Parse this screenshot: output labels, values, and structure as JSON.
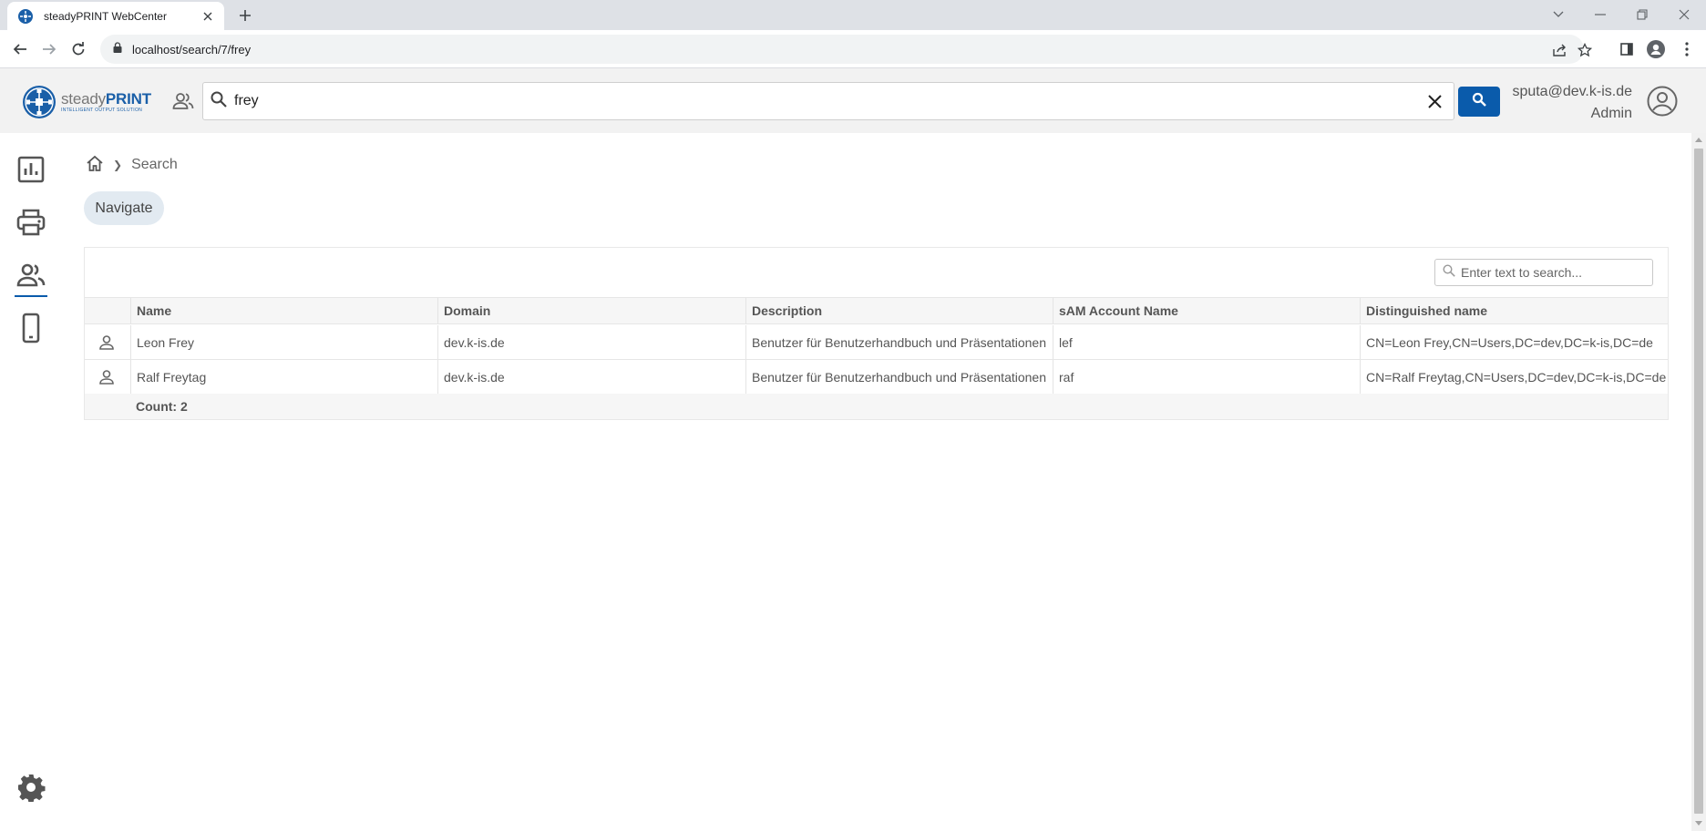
{
  "browser": {
    "tab_title": "steadyPRINT WebCenter",
    "url": "localhost/search/7/frey"
  },
  "header": {
    "logo_name_light": "steady",
    "logo_name_bold": "PRINT",
    "logo_tagline": "INTELLIGENT OUTPUT SOLUTION",
    "search_query": "frey",
    "user_email": "sputa@dev.k-is.de",
    "user_role": "Admin"
  },
  "sidebar": {
    "items": [
      {
        "name": "dashboard",
        "icon": "bar-chart-icon"
      },
      {
        "name": "printers",
        "icon": "printer-icon"
      },
      {
        "name": "users",
        "icon": "users-icon",
        "active": true
      },
      {
        "name": "devices",
        "icon": "mobile-icon"
      }
    ],
    "settings_icon": "gear-icon"
  },
  "breadcrumb": {
    "current": "Search"
  },
  "main": {
    "navigate_label": "Navigate",
    "table_search_placeholder": "Enter text to search...",
    "columns": [
      "Name",
      "Domain",
      "Description",
      "sAM Account Name",
      "Distinguished name"
    ],
    "rows": [
      {
        "name": "Leon Frey",
        "domain": "dev.k-is.de",
        "description": "Benutzer für Benutzerhandbuch und Präsentationen",
        "sam": "lef",
        "dn": "CN=Leon Frey,CN=Users,DC=dev,DC=k-is,DC=de"
      },
      {
        "name": "Ralf Freytag",
        "domain": "dev.k-is.de",
        "description": "Benutzer für Benutzerhandbuch und Präsentationen",
        "sam": "raf",
        "dn": "CN=Ralf Freytag,CN=Users,DC=dev,DC=k-is,DC=de"
      }
    ],
    "count_label": "Count: 2"
  },
  "colors": {
    "accent": "#0a5bab",
    "header_bg": "#f2f2f2",
    "navigate_bg": "#e2eaf1"
  }
}
